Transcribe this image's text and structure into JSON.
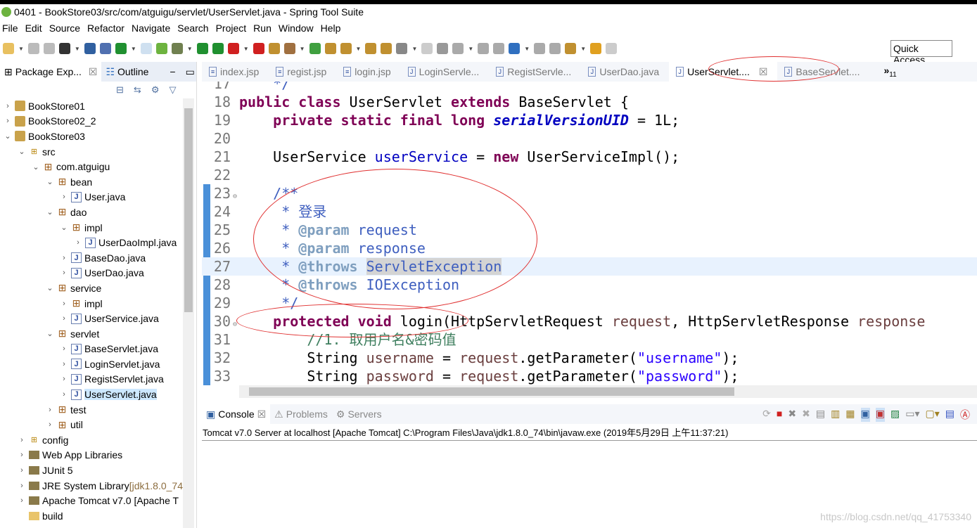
{
  "window": {
    "title": "0401 - BookStore03/src/com/atguigu/servlet/UserServlet.java - Spring Tool Suite"
  },
  "menu": [
    "File",
    "Edit",
    "Source",
    "Refactor",
    "Navigate",
    "Search",
    "Project",
    "Run",
    "Window",
    "Help"
  ],
  "toolbar": {
    "quick_access": "Quick Access"
  },
  "left_panel": {
    "tabs": [
      {
        "label": "Package Exp...",
        "active": true
      },
      {
        "label": "Outline",
        "active": false
      }
    ],
    "tree": [
      {
        "label": "BookStore01",
        "depth": 0,
        "exp": "›",
        "icon": "proj"
      },
      {
        "label": "BookStore02_2",
        "depth": 0,
        "exp": "›",
        "icon": "proj"
      },
      {
        "label": "BookStore03",
        "depth": 0,
        "exp": "⌄",
        "icon": "proj"
      },
      {
        "label": "src",
        "depth": 1,
        "exp": "⌄",
        "icon": "src"
      },
      {
        "label": "com.atguigu",
        "depth": 2,
        "exp": "⌄",
        "icon": "pkg"
      },
      {
        "label": "bean",
        "depth": 3,
        "exp": "⌄",
        "icon": "pkg"
      },
      {
        "label": "User.java",
        "depth": 4,
        "exp": "›",
        "icon": "java"
      },
      {
        "label": "dao",
        "depth": 3,
        "exp": "⌄",
        "icon": "pkg"
      },
      {
        "label": "impl",
        "depth": 4,
        "exp": "⌄",
        "icon": "pkg"
      },
      {
        "label": "UserDaoImpl.java",
        "depth": 5,
        "exp": "›",
        "icon": "java"
      },
      {
        "label": "BaseDao.java",
        "depth": 4,
        "exp": "›",
        "icon": "java"
      },
      {
        "label": "UserDao.java",
        "depth": 4,
        "exp": "›",
        "icon": "java"
      },
      {
        "label": "service",
        "depth": 3,
        "exp": "⌄",
        "icon": "pkg"
      },
      {
        "label": "impl",
        "depth": 4,
        "exp": "›",
        "icon": "pkg"
      },
      {
        "label": "UserService.java",
        "depth": 4,
        "exp": "›",
        "icon": "java"
      },
      {
        "label": "servlet",
        "depth": 3,
        "exp": "⌄",
        "icon": "pkg"
      },
      {
        "label": "BaseServlet.java",
        "depth": 4,
        "exp": "›",
        "icon": "java"
      },
      {
        "label": "LoginServlet.java",
        "depth": 4,
        "exp": "›",
        "icon": "java"
      },
      {
        "label": "RegistServlet.java",
        "depth": 4,
        "exp": "›",
        "icon": "java"
      },
      {
        "label": "UserServlet.java",
        "depth": 4,
        "exp": "›",
        "icon": "java",
        "selected": true
      },
      {
        "label": "test",
        "depth": 3,
        "exp": "›",
        "icon": "pkg"
      },
      {
        "label": "util",
        "depth": 3,
        "exp": "›",
        "icon": "pkg"
      },
      {
        "label": "config",
        "depth": 1,
        "exp": "›",
        "icon": "src"
      },
      {
        "label": "Web App Libraries",
        "depth": 1,
        "exp": "›",
        "icon": "lib"
      },
      {
        "label": "JUnit 5",
        "depth": 1,
        "exp": "›",
        "icon": "lib"
      },
      {
        "label": "JRE System Library",
        "depth": 1,
        "exp": "›",
        "icon": "lib",
        "decoration": " [jdk1.8.0_74"
      },
      {
        "label": "Apache Tomcat v7.0 [Apache T",
        "depth": 1,
        "exp": "›",
        "icon": "lib"
      },
      {
        "label": "build",
        "depth": 1,
        "exp": "",
        "icon": "folder"
      }
    ]
  },
  "editor": {
    "tabs": [
      {
        "label": "index.jsp",
        "icon": "jsp"
      },
      {
        "label": "regist.jsp",
        "icon": "jsp"
      },
      {
        "label": "login.jsp",
        "icon": "jsp"
      },
      {
        "label": "LoginServle...",
        "icon": "java"
      },
      {
        "label": "RegistServle...",
        "icon": "java"
      },
      {
        "label": "UserDao.java",
        "icon": "java"
      },
      {
        "label": "UserServlet....",
        "icon": "java",
        "active": true
      },
      {
        "label": "BaseServlet....",
        "icon": "java"
      }
    ],
    "overflow": "»",
    "overflow_count": "11",
    "lines": [
      {
        "n": "17",
        "t": [
          [
            "    */",
            "jd"
          ]
        ]
      },
      {
        "n": "18",
        "t": [
          [
            "public class ",
            "kw"
          ],
          [
            "UserServlet ",
            ""
          ],
          [
            "extends ",
            "kw"
          ],
          [
            "BaseServlet {",
            ""
          ]
        ]
      },
      {
        "n": "19",
        "t": [
          [
            "    ",
            ""
          ],
          [
            "private static final long ",
            "kw"
          ],
          [
            "serialVersionUID",
            "sfld"
          ],
          [
            " = 1L;",
            ""
          ]
        ]
      },
      {
        "n": "20",
        "t": []
      },
      {
        "n": "21",
        "t": [
          [
            "    UserService ",
            ""
          ],
          [
            "userService",
            "fld"
          ],
          [
            " = ",
            ""
          ],
          [
            "new ",
            "kw"
          ],
          [
            "UserServiceImpl();",
            ""
          ]
        ]
      },
      {
        "n": "22",
        "t": []
      },
      {
        "n": "23",
        "fold": "⊖",
        "t": [
          [
            "    /**",
            "jd"
          ]
        ]
      },
      {
        "n": "24",
        "t": [
          [
            "     * 登录",
            "jd"
          ]
        ]
      },
      {
        "n": "25",
        "t": [
          [
            "     * ",
            "jd"
          ],
          [
            "@param",
            "tag"
          ],
          [
            " request",
            "jd"
          ]
        ]
      },
      {
        "n": "26",
        "t": [
          [
            "     * ",
            "jd"
          ],
          [
            "@param",
            "tag"
          ],
          [
            " response",
            "jd"
          ]
        ]
      },
      {
        "n": "27",
        "hl": true,
        "t": [
          [
            "     * ",
            "jd"
          ],
          [
            "@throws",
            "tag"
          ],
          [
            " ",
            "jd"
          ],
          [
            "ServletException",
            "jd occ"
          ]
        ]
      },
      {
        "n": "28",
        "t": [
          [
            "     * ",
            "jd"
          ],
          [
            "@throws",
            "tag"
          ],
          [
            " IOException",
            "jd"
          ]
        ]
      },
      {
        "n": "29",
        "t": [
          [
            "     */",
            "jd"
          ]
        ]
      },
      {
        "n": "30",
        "fold": "⊖",
        "t": [
          [
            "    ",
            ""
          ],
          [
            "protected void ",
            "kw"
          ],
          [
            "login(HttpServletRequest ",
            ""
          ],
          [
            "request",
            "var"
          ],
          [
            ", HttpServletResponse ",
            ""
          ],
          [
            "response",
            "var"
          ]
        ]
      },
      {
        "n": "31",
        "t": [
          [
            "        //1. 取用户名&密码值",
            "cm"
          ]
        ]
      },
      {
        "n": "32",
        "t": [
          [
            "        String ",
            ""
          ],
          [
            "username",
            "var"
          ],
          [
            " = ",
            ""
          ],
          [
            "request",
            "var"
          ],
          [
            ".getParameter(",
            ""
          ],
          [
            "\"username\"",
            "str"
          ],
          [
            ");",
            ""
          ]
        ]
      },
      {
        "n": "33",
        "t": [
          [
            "        String ",
            ""
          ],
          [
            "password",
            "var"
          ],
          [
            " = ",
            ""
          ],
          [
            "request",
            "var"
          ],
          [
            ".getParameter(",
            ""
          ],
          [
            "\"password\"",
            "str"
          ],
          [
            ");",
            ""
          ]
        ]
      }
    ]
  },
  "console": {
    "tabs": [
      {
        "label": "Console",
        "active": true
      },
      {
        "label": "Problems"
      },
      {
        "label": "Servers"
      }
    ],
    "status": "Tomcat v7.0 Server at localhost [Apache Tomcat] C:\\Program Files\\Java\\jdk1.8.0_74\\bin\\javaw.exe (2019年5月29日 上午11:37:21)"
  },
  "watermark": "https://blog.csdn.net/qq_41753340",
  "colors": {
    "annotation": "#e03030",
    "selection": "#cde8ff",
    "keyword": "#7f0055"
  }
}
